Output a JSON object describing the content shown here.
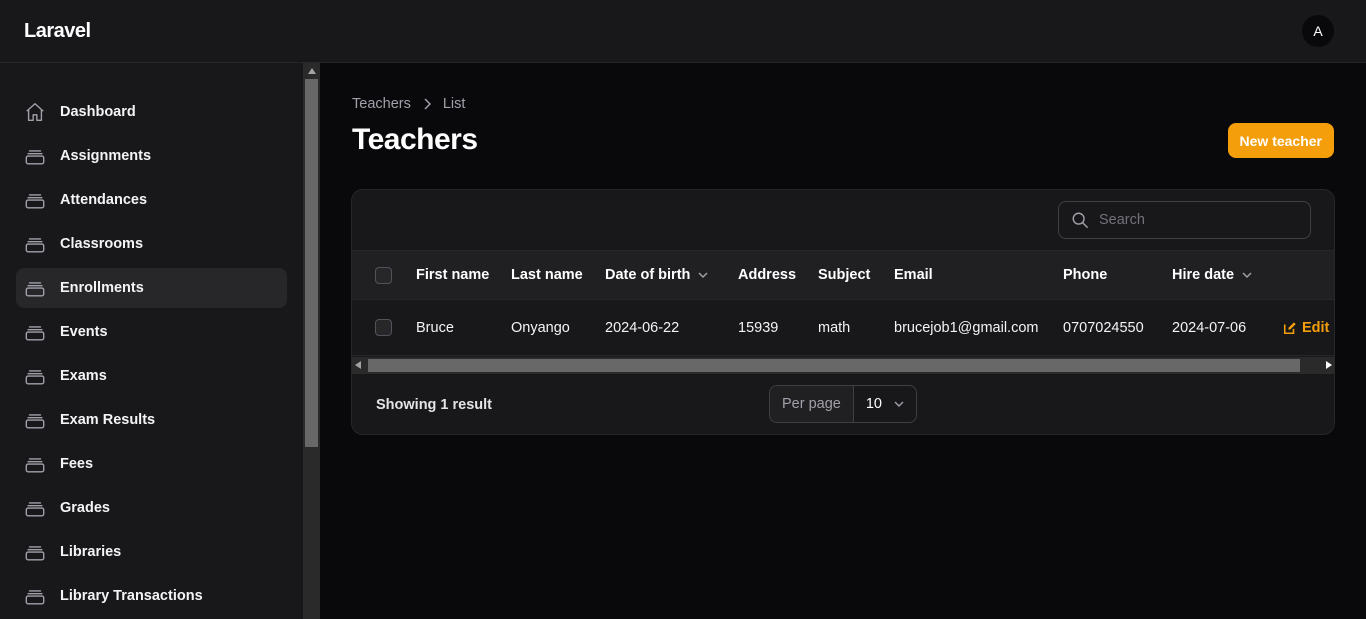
{
  "app": {
    "brand": "Laravel",
    "avatar_initial": "A"
  },
  "sidebar": {
    "items": [
      {
        "label": "Dashboard",
        "icon": "home-icon",
        "active": false
      },
      {
        "label": "Assignments",
        "icon": "stack-icon",
        "active": false
      },
      {
        "label": "Attendances",
        "icon": "stack-icon",
        "active": false
      },
      {
        "label": "Classrooms",
        "icon": "stack-icon",
        "active": false
      },
      {
        "label": "Enrollments",
        "icon": "stack-icon",
        "active": true
      },
      {
        "label": "Events",
        "icon": "stack-icon",
        "active": false
      },
      {
        "label": "Exams",
        "icon": "stack-icon",
        "active": false
      },
      {
        "label": "Exam Results",
        "icon": "stack-icon",
        "active": false
      },
      {
        "label": "Fees",
        "icon": "stack-icon",
        "active": false
      },
      {
        "label": "Grades",
        "icon": "stack-icon",
        "active": false
      },
      {
        "label": "Libraries",
        "icon": "stack-icon",
        "active": false
      },
      {
        "label": "Library Transactions",
        "icon": "stack-icon",
        "active": false
      }
    ]
  },
  "breadcrumb": {
    "parent": "Teachers",
    "current": "List"
  },
  "page": {
    "title": "Teachers",
    "new_button": "New teacher"
  },
  "search": {
    "placeholder": "Search",
    "value": ""
  },
  "table": {
    "columns": {
      "first_name": "First name",
      "last_name": "Last name",
      "date_of_birth": "Date of birth",
      "address": "Address",
      "subject": "Subject",
      "email": "Email",
      "phone": "Phone",
      "hire_date": "Hire date"
    },
    "rows": [
      {
        "first_name": "Bruce",
        "last_name": "Onyango",
        "date_of_birth": "2024-06-22",
        "address": "15939",
        "subject": "math",
        "email": "brucejob1@gmail.com",
        "phone": "0707024550",
        "hire_date": "2024-07-06",
        "action": "Edit"
      }
    ]
  },
  "footer": {
    "showing": "Showing 1 result",
    "per_page_label": "Per page",
    "per_page_value": "10"
  },
  "colors": {
    "accent": "#f59e0b",
    "background": "#09090b",
    "panel": "#18181b"
  }
}
